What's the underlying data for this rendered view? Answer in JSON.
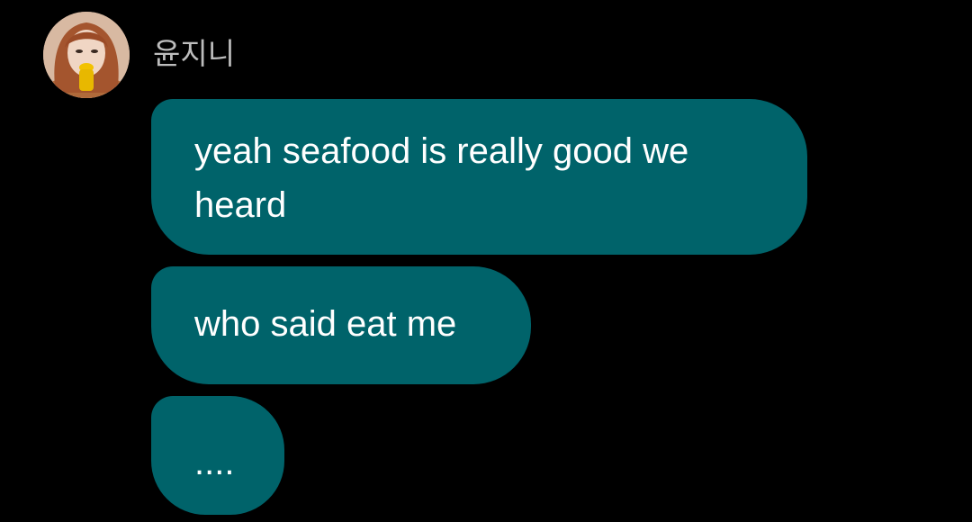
{
  "chat": {
    "sender_name": "윤지니",
    "messages": [
      {
        "text": "yeah seafood is really good we heard"
      },
      {
        "text": "who said eat me"
      },
      {
        "text": "...."
      }
    ]
  },
  "colors": {
    "background": "#000000",
    "bubble": "#00636a",
    "message_text": "#ffffff",
    "sender_name": "#bdbdbd"
  },
  "icons": {
    "avatar": "profile-photo"
  }
}
